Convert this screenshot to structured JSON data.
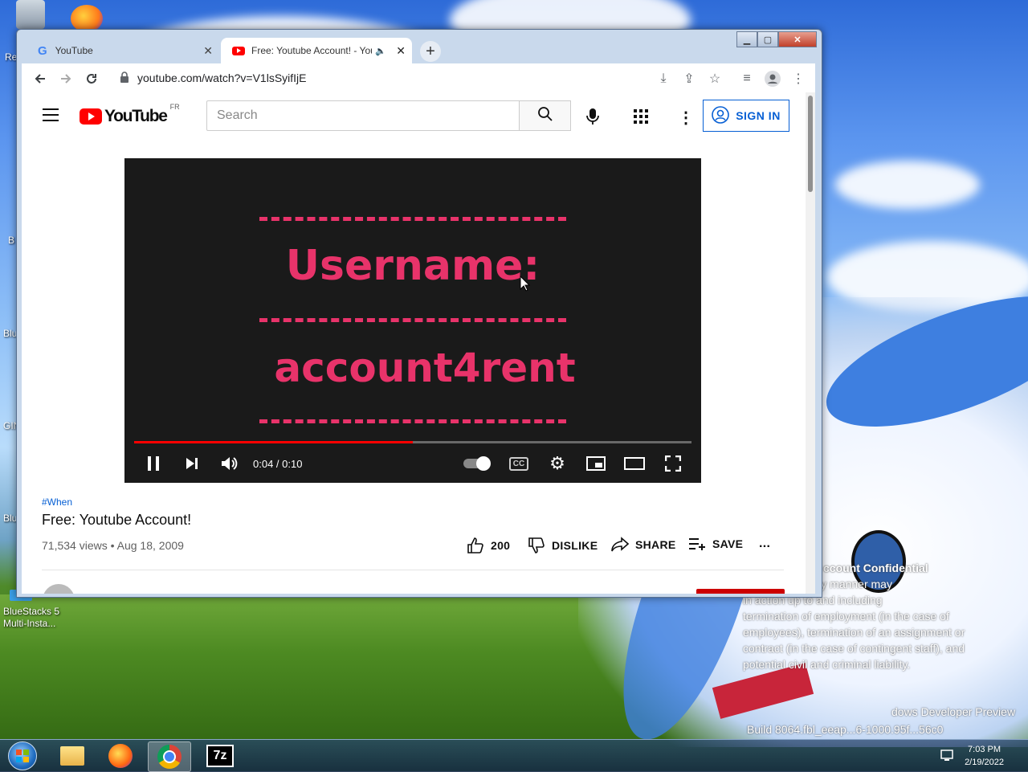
{
  "desktop": {
    "icons": [
      {
        "label": "Re"
      },
      {
        "label": "B"
      },
      {
        "label": "Blu"
      },
      {
        "label": "GIN"
      },
      {
        "label": "Blu"
      },
      {
        "label": "BlueStacks 5\nMulti-Insta..."
      }
    ],
    "watermark": {
      "title": "ccount Confidential",
      "body": "disclosure in any manner may\nin action up to and including\ntermination of employment (in the case of\nemployees), termination of an assignment or\ncontract (in the case of contingent staff), and\npotential civil and criminal liability."
    },
    "build_line1": "dows Developer Preview",
    "build_line2": "Build 8064.fbl_eeap...6-1000.95f...56c0"
  },
  "taskbar": {
    "clock_time": "7:03 PM",
    "clock_date": "2/19/2022",
    "apps": [
      "start-orb",
      "file-explorer",
      "firefox",
      "chrome",
      "7zip"
    ],
    "zip_label": "7z"
  },
  "browser": {
    "tabs": [
      {
        "title": "YouTube",
        "active": false
      },
      {
        "title": "Free: Youtube Account! - You",
        "active": true
      }
    ],
    "new_tab": "+",
    "url": "youtube.com/watch?v=V1lsSyifIjE"
  },
  "youtube": {
    "logo_text": "YouTube",
    "region": "FR",
    "search_placeholder": "Search",
    "sign_in": "SIGN IN",
    "video": {
      "line1": "Username:",
      "line2": "account4rent",
      "time": "0:04 / 0:10",
      "progress": 0.5,
      "cc": "CC"
    },
    "hashtag": "#When",
    "title": "Free: Youtube Account!",
    "meta": "71,534 views • Aug 18, 2009",
    "actions": {
      "likes": "200",
      "dislike": "DISLIKE",
      "share": "SHARE",
      "save": "SAVE",
      "more": "..."
    }
  }
}
